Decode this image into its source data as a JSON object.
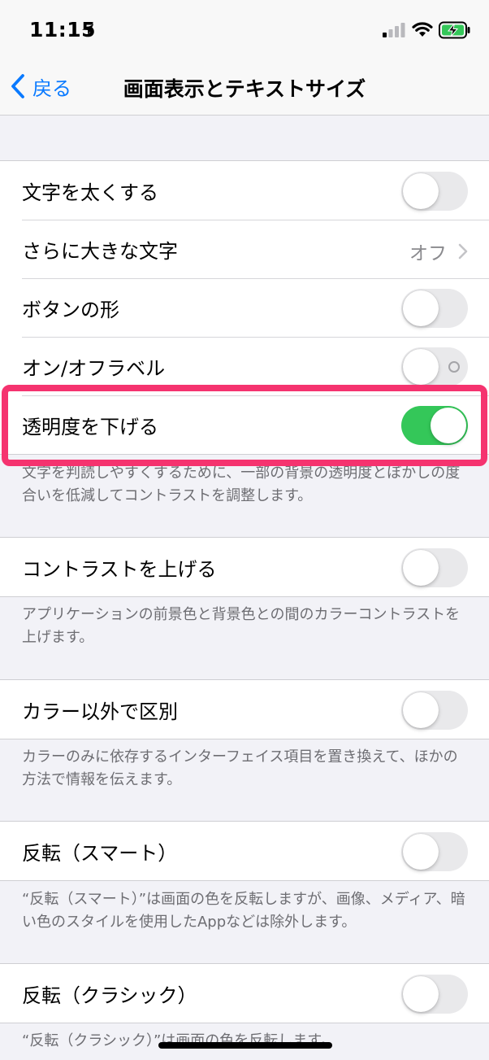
{
  "status": {
    "time": "11:15"
  },
  "nav": {
    "back_label": "戻る",
    "title": "画面表示とテキストサイズ"
  },
  "rows": {
    "bold_text": {
      "label": "文字を太くする",
      "on": false
    },
    "larger_text": {
      "label": "さらに大きな文字",
      "value": "オフ"
    },
    "button_shapes": {
      "label": "ボタンの形",
      "on": false
    },
    "on_off_labels": {
      "label": "オン/オフラベル",
      "on": false
    },
    "reduce_transparency": {
      "label": "透明度を下げる",
      "on": true
    },
    "increase_contrast": {
      "label": "コントラストを上げる",
      "on": false
    },
    "differentiate_without_color": {
      "label": "カラー以外で区別",
      "on": false
    },
    "smart_invert": {
      "label": "反転（スマート）",
      "on": false
    },
    "classic_invert": {
      "label": "反転（クラシック）",
      "on": false
    }
  },
  "footers": {
    "reduce_transparency": "文字を判読しやすくするために、一部の背景の透明度とぼかしの度合いを低減してコントラストを調整します。",
    "increase_contrast": "アプリケーションの前景色と背景色との間のカラーコントラストを上げます。",
    "differentiate_without_color": "カラーのみに依存するインターフェイス項目を置き換えて、ほかの方法で情報を伝えます。",
    "smart_invert": "“反転（スマート）”は画面の色を反転しますが、画像、メディア、暗い色のスタイルを使用したAppなどは除外します。",
    "classic_invert": "“反転（クラシック）”は画面の色を反転します。"
  },
  "colors": {
    "accent": "#0a7aff",
    "toggle_on": "#34c759",
    "highlight": "#f5336f"
  },
  "icons": [
    "location-arrow-icon",
    "cellular-signal-icon",
    "wifi-icon",
    "battery-charging-icon",
    "chevron-left-icon",
    "chevron-right-icon"
  ]
}
